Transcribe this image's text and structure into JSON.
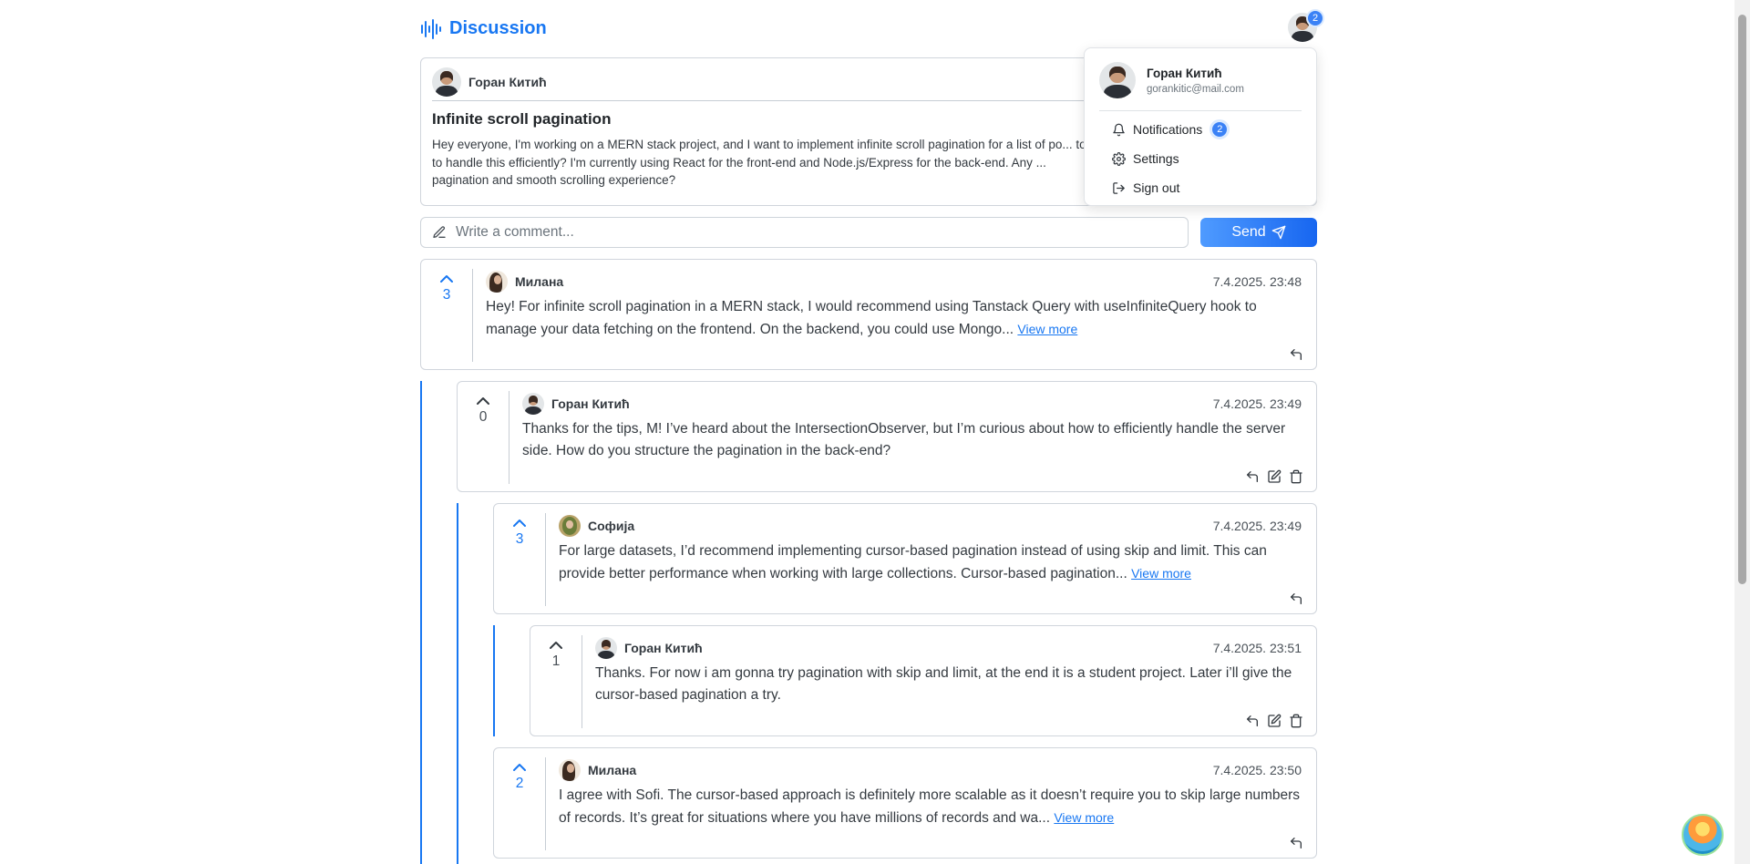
{
  "header": {
    "title": "Discussion",
    "notification_count": "2"
  },
  "post": {
    "author": "Горан Китић",
    "title": "Infinite scroll pagination",
    "body": "Hey everyone, I'm working on a MERN stack project, and I want to implement infinite scroll pagination for a list of po... tools to handle this efficiently? I'm currently using React for the front-end and Node.js/Express for the back-end. Any ... pagination and smooth scrolling experience?"
  },
  "comment_input": {
    "placeholder": "Write a comment...",
    "send_label": "Send"
  },
  "comments": [
    {
      "author": "Милана",
      "date": "7.4.2025. 23:48",
      "votes": "3",
      "body": "Hey! For infinite scroll pagination in a MERN stack, I would recommend using Tanstack Query with useInfiniteQuery hook to manage your data fetching on the frontend. On the backend, you could use Mongo...",
      "view_more": "View more"
    },
    {
      "author": "Горан Китић",
      "date": "7.4.2025. 23:49",
      "votes": "0",
      "body": "Thanks for the tips, M! I’ve heard about the IntersectionObserver, but I’m curious about how to efficiently handle the server side. How do you structure the pagination in the back-end?"
    },
    {
      "author": "Софија",
      "date": "7.4.2025. 23:49",
      "votes": "3",
      "body": "For large datasets, I’d recommend implementing cursor-based pagination instead of using skip and limit. This can provide better performance when working with large collections. Cursor-based pagination...",
      "view_more": "View more"
    },
    {
      "author": "Горан Китић",
      "date": "7.4.2025. 23:51",
      "votes": "1",
      "body": "Thanks. For now i am gonna try pagination with skip and limit, at the end it is a student project. Later i’ll give the cursor-based pagination a try."
    },
    {
      "author": "Милана",
      "date": "7.4.2025. 23:50",
      "votes": "2",
      "body": "I agree with Sofi. The cursor-based approach is definitely more scalable as it doesn’t require you to skip large numbers of records. It’s great for situations where you have millions of records and wa...",
      "view_more": "View more"
    }
  ],
  "user_menu": {
    "name": "Горан Китић",
    "email": "gorankitic@mail.com",
    "items": [
      {
        "label": "Notifications",
        "badge": "2",
        "icon": "bell-icon"
      },
      {
        "label": "Settings",
        "icon": "gear-icon"
      },
      {
        "label": "Sign out",
        "icon": "sign-out-icon"
      }
    ]
  },
  "colors": {
    "accent": "#1877f2",
    "thread_line": "#1877f2",
    "badge": "#3b82f6"
  }
}
